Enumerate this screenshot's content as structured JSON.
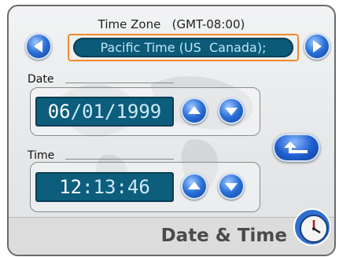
{
  "time_zone": {
    "label": "Time Zone",
    "offset": "(GMT-08:00)",
    "value": "Pacific Time (US  Canada);"
  },
  "date": {
    "label": "Date",
    "month": "06",
    "sep1": "/",
    "day": "01",
    "sep2": "/",
    "year": "1999"
  },
  "time": {
    "label": "Time",
    "hour": "12",
    "sep1": ":",
    "minute": "13",
    "sep2": ":",
    "second": "46"
  },
  "footer": {
    "title": "Date & Time"
  },
  "icons": [
    "left-arrow-icon",
    "right-arrow-icon",
    "up-arrow-icon",
    "down-arrow-icon",
    "back-icon",
    "clock-icon"
  ],
  "colors": {
    "accent": "#2a6fd6",
    "field_bg": "#0d5d7c",
    "highlight_border": "#f08a2c"
  }
}
